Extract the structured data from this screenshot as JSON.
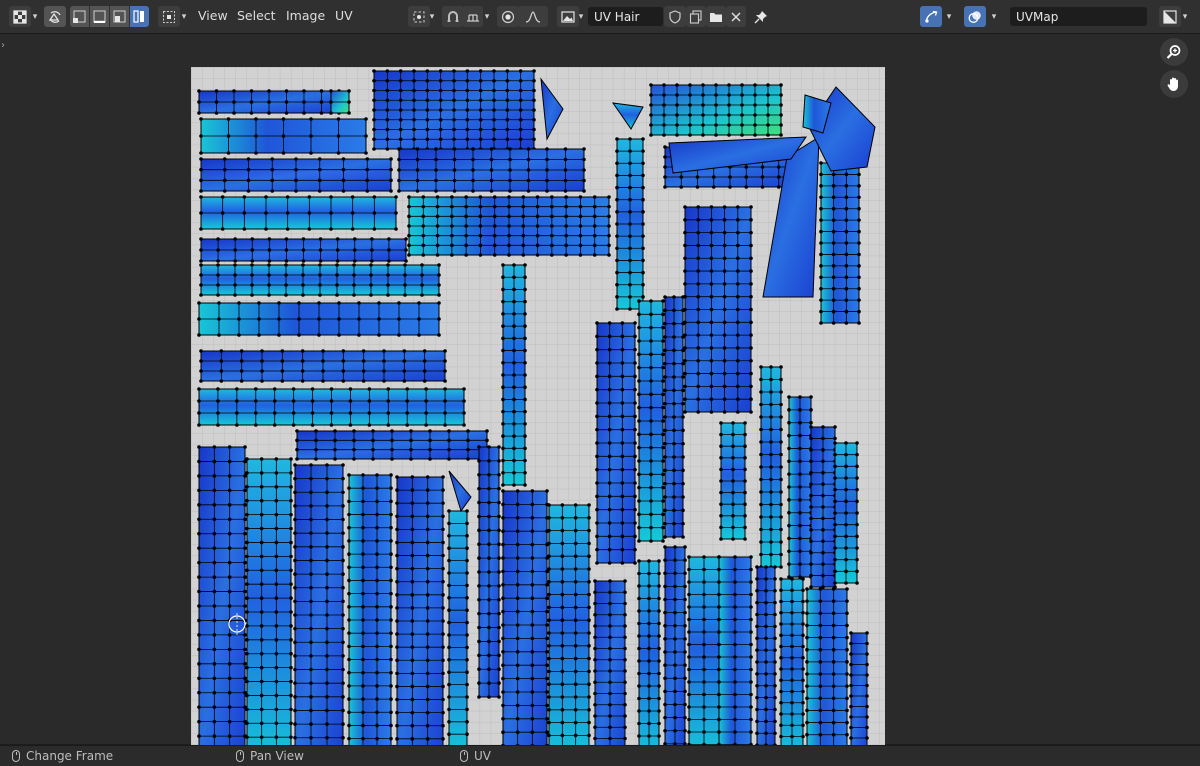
{
  "header": {
    "menus": {
      "view": "View",
      "select": "Select",
      "image": "Image",
      "uv": "UV"
    },
    "image_name": "UV Hair",
    "uv_map_name": "UVMap",
    "icons": {
      "editor_type": "uv-editor-icon",
      "sync": "uv-sync-selection-icon",
      "select_modes": [
        "vertex-select-icon",
        "edge-select-icon",
        "face-select-icon",
        "island-select-icon"
      ],
      "sticky": "sticky-selection-icon",
      "pivot": "pivot-point-icon",
      "snap": "snap-magnet-icon",
      "snap_target": "snap-increment-icon",
      "proportional": "proportional-editing-icon",
      "falloff": "falloff-curve-icon",
      "image_browse": "image-browse-icon",
      "fake_user": "fake-user-shield-icon",
      "new_image": "new-image-icon",
      "open_image": "open-folder-icon",
      "unlink": "close-icon",
      "pin": "pin-icon",
      "gizmo": "gizmo-icon",
      "overlay": "overlay-icon",
      "display_mode": "display-channels-icon"
    },
    "accent_color": "#4772b3"
  },
  "viewport": {
    "nav_icons": [
      "zoom-icon",
      "pan-hand-icon"
    ],
    "uv_mesh_colors": [
      "#1a35c8",
      "#2a6ae0",
      "#16c6dc",
      "#38e07a"
    ]
  },
  "statusbar": {
    "left": "Change Frame",
    "middle": "Pan View",
    "right": "UV"
  }
}
